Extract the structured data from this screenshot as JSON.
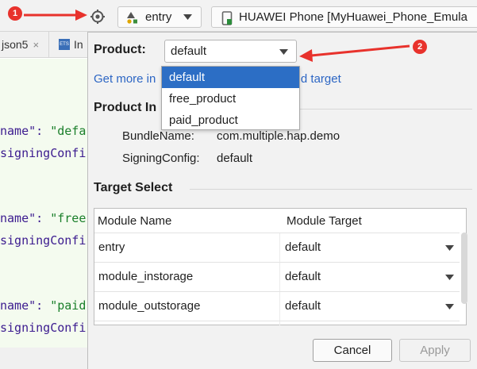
{
  "toolbar": {
    "entry_label": "entry",
    "device_label": "HUAWEI Phone [MyHuawei_Phone_Emula"
  },
  "annotations": [
    "1",
    "2"
  ],
  "editor": {
    "tabs": [
      "json5",
      "In"
    ],
    "code_lines": [
      {
        "a": "name\": ",
        "b": "\"defa"
      },
      {
        "a": "signingConfi",
        "b": ""
      },
      {
        "a": "name\": ",
        "b": "\"free"
      },
      {
        "a": "signingConfi",
        "b": ""
      },
      {
        "a": "name\": ",
        "b": "\"paid"
      },
      {
        "a": "signingConfi",
        "b": ""
      }
    ]
  },
  "panel": {
    "product_label": "Product:",
    "product_value": "default",
    "product_options": [
      "default",
      "free_product",
      "paid_product"
    ],
    "help_link": "Get more in",
    "help_link_tail": "ct and target",
    "info_title": "Product In",
    "bundle_key": "BundleName:",
    "bundle_value": "com.multiple.hap.demo",
    "signing_key": "SigningConfig:",
    "signing_value": "default",
    "target_title": "Target Select",
    "table": {
      "headers": [
        "Module Name",
        "Module Target"
      ],
      "rows": [
        {
          "module": "entry",
          "target": "default"
        },
        {
          "module": "module_instorage",
          "target": "default"
        },
        {
          "module": "module_outstorage",
          "target": "default"
        }
      ]
    },
    "cancel_label": "Cancel",
    "apply_label": "Apply"
  },
  "colors": {
    "badge": "#e8322c",
    "link": "#2d66c4",
    "selection": "#2c6ec5"
  }
}
